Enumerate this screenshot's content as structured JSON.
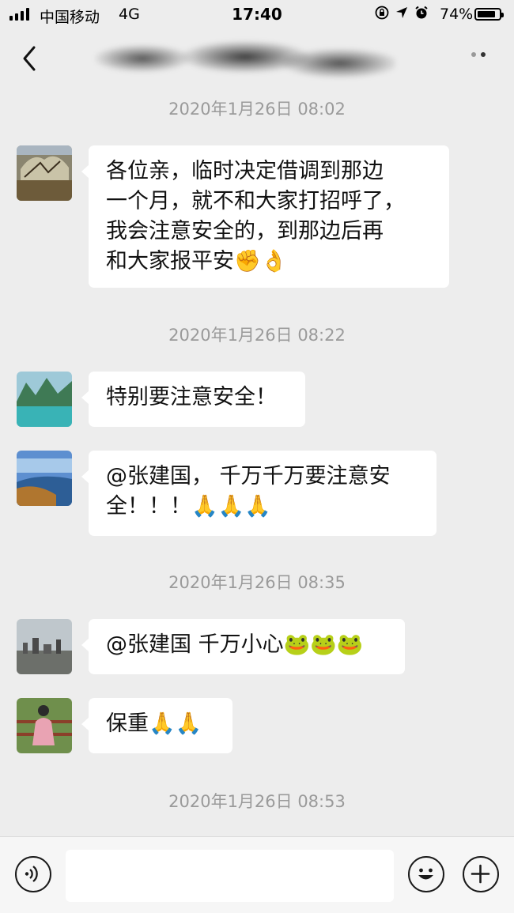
{
  "status_bar": {
    "carrier": "中国移动",
    "network": "4G",
    "time": "17:40",
    "battery_pct": "74%",
    "icons": [
      "signal-icon",
      "lock-rotation-icon",
      "location-icon",
      "alarm-icon",
      "battery-icon"
    ]
  },
  "nav": {
    "back_icon": "chevron-left-icon",
    "more_icon": "more-dots-icon"
  },
  "messages": [
    {
      "type": "time",
      "text": "2020年1月26日 08:02"
    },
    {
      "type": "text",
      "text_lines": [
        "各位亲，临时决定借调到那边",
        "一个月，就不和大家打招呼了，",
        "我会注意安全的，到那边后再",
        "和大家报平安✊👌"
      ]
    },
    {
      "type": "time",
      "text": "2020年1月26日 08:22"
    },
    {
      "type": "text",
      "text_lines": [
        "特别要注意安全！"
      ]
    },
    {
      "type": "text",
      "text_lines": [
        "@张建国，  千万千万要注意安",
        "全！！！🙏🙏🙏"
      ]
    },
    {
      "type": "time",
      "text": "2020年1月26日 08:35"
    },
    {
      "type": "text",
      "text_lines": [
        "@张建国 千万小心🐸🐸🐸"
      ]
    },
    {
      "type": "text",
      "text_lines": [
        "保重🙏🙏"
      ]
    },
    {
      "type": "time",
      "text": "2020年1月26日 08:53"
    }
  ],
  "input_bar": {
    "voice_icon": "voice-icon",
    "emoji_icon": "emoji-smile-icon",
    "plus_icon": "plus-icon",
    "input_value": ""
  },
  "colors": {
    "background": "#ededed",
    "bubble": "#ffffff",
    "timestamp": "#9a9a9a"
  }
}
